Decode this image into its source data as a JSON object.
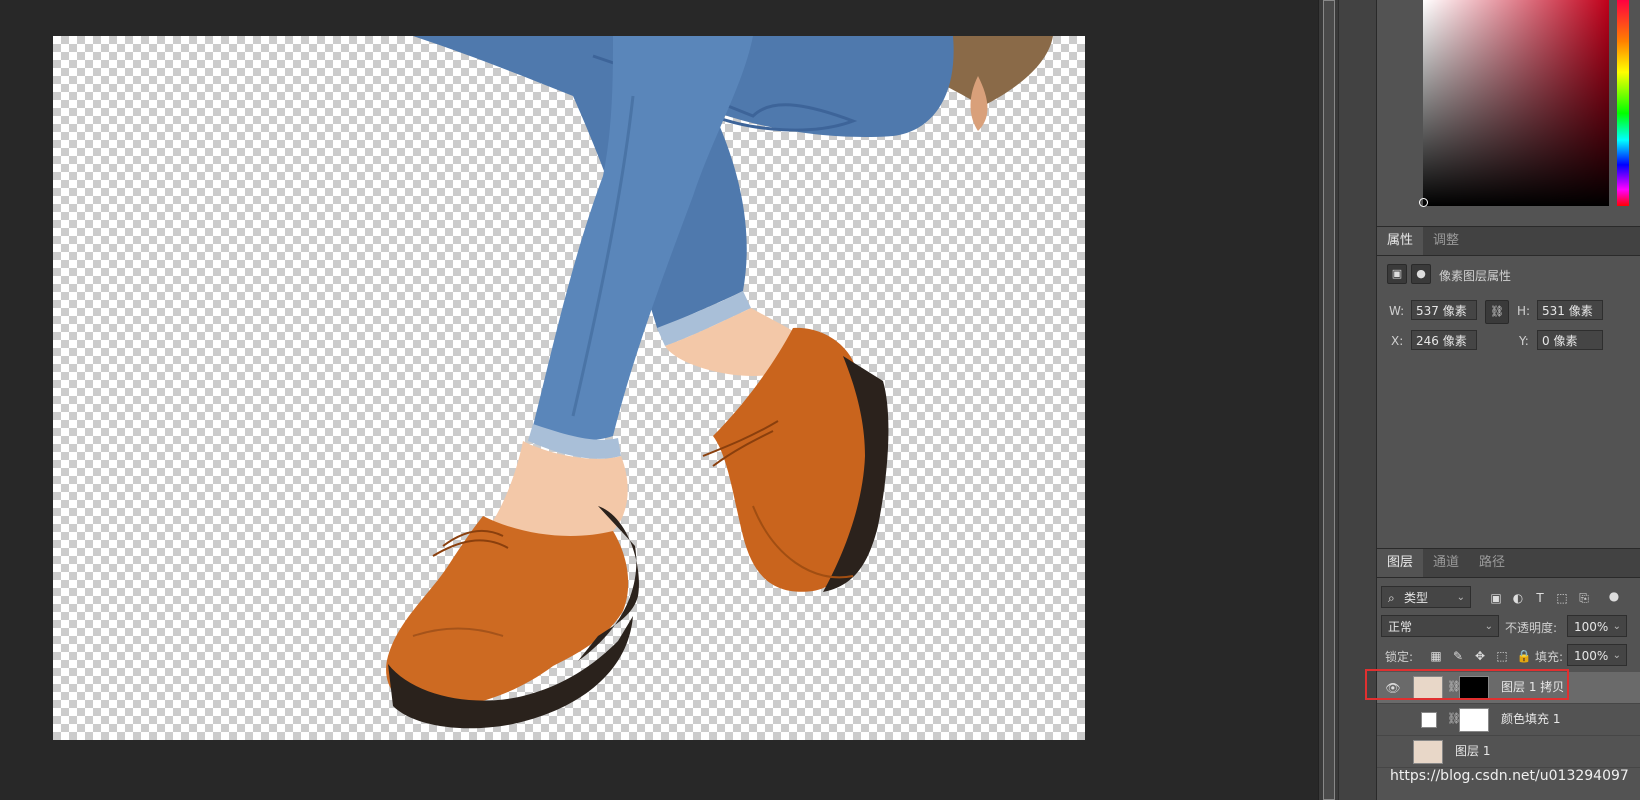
{
  "properties_panel": {
    "tabs": [
      "属性",
      "调整"
    ],
    "subtitle": "像素图层属性",
    "w_label": "W:",
    "w_value": "537 像素",
    "h_label": "H:",
    "h_value": "531 像素",
    "x_label": "X:",
    "x_value": "246 像素",
    "y_label": "Y:",
    "y_value": "0 像素"
  },
  "layers_panel": {
    "tabs": [
      "图层",
      "通道",
      "路径"
    ],
    "filter_kind": "类型",
    "blend_mode": "正常",
    "opacity_label": "不透明度:",
    "opacity_value": "100%",
    "lock_label": "锁定:",
    "fill_label": "填充:",
    "fill_value": "100%",
    "layers": [
      {
        "name": "图层 1 拷贝",
        "visible": true,
        "selected": true
      },
      {
        "name": "颜色填充 1",
        "visible": false,
        "selected": false
      },
      {
        "name": "图层 1",
        "visible": false,
        "selected": false
      }
    ]
  },
  "watermark": "https://blog.csdn.net/u013294097",
  "colors": {
    "highlight_box": "#e03030",
    "panel_bg": "#535353",
    "selected_layer": "#6a6a6a"
  }
}
